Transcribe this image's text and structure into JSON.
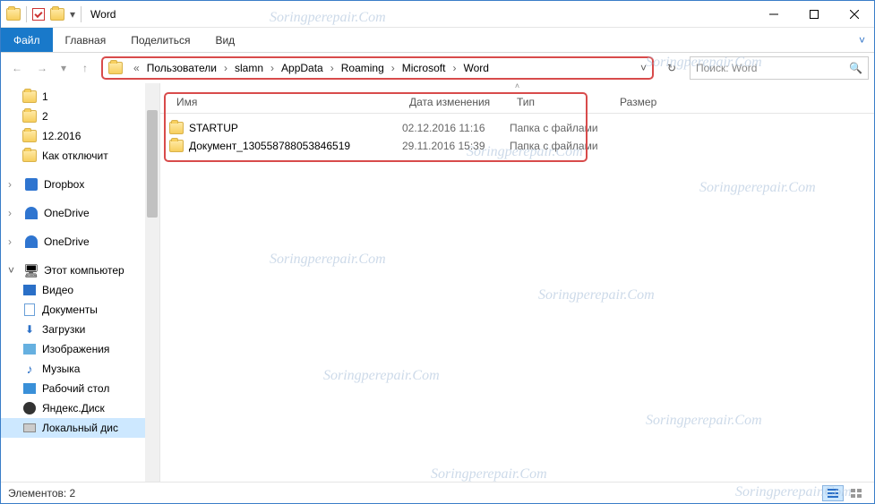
{
  "titlebar": {
    "title": "Word"
  },
  "ribbon": {
    "file": "Файл",
    "home": "Главная",
    "share": "Поделиться",
    "view": "Вид"
  },
  "breadcrumb": {
    "items": [
      "Пользователи",
      "slamn",
      "AppData",
      "Roaming",
      "Microsoft",
      "Word"
    ]
  },
  "search": {
    "placeholder": "Поиск: Word"
  },
  "columns": {
    "name": "Имя",
    "date": "Дата изменения",
    "type": "Тип",
    "size": "Размер"
  },
  "sidebar": {
    "quick": [
      {
        "label": "1",
        "icon": "folder"
      },
      {
        "label": "2",
        "icon": "folder"
      },
      {
        "label": "12.2016",
        "icon": "folder"
      },
      {
        "label": "Как отключит",
        "icon": "folder"
      }
    ],
    "cloud": [
      {
        "label": "Dropbox",
        "icon": "dropbox"
      },
      {
        "label": "OneDrive",
        "icon": "onedrive"
      },
      {
        "label": "OneDrive",
        "icon": "onedrive"
      }
    ],
    "pc_label": "Этот компьютер",
    "pc_children": [
      {
        "label": "Видео",
        "icon": "video"
      },
      {
        "label": "Документы",
        "icon": "doc"
      },
      {
        "label": "Загрузки",
        "icon": "download"
      },
      {
        "label": "Изображения",
        "icon": "image"
      },
      {
        "label": "Музыка",
        "icon": "music"
      },
      {
        "label": "Рабочий стол",
        "icon": "desktop"
      },
      {
        "label": "Яндекс.Диск",
        "icon": "yadisk"
      },
      {
        "label": "Локальный дис",
        "icon": "disk"
      }
    ]
  },
  "files": [
    {
      "name": "STARTUP",
      "date": "02.12.2016 11:16",
      "type": "Папка с файлами"
    },
    {
      "name": "Документ_130558788053846519",
      "date": "29.11.2016 15:39",
      "type": "Папка с файлами"
    }
  ],
  "status": {
    "count_label": "Элементов: 2"
  },
  "watermark": "Soringperepair.Com"
}
